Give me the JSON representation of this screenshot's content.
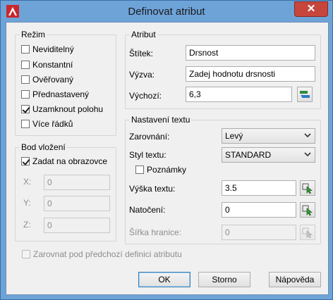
{
  "window": {
    "title": "Definovat atribut",
    "close_glyph": "✕"
  },
  "mode": {
    "legend": "Režim",
    "items": [
      {
        "label": "Neviditelný",
        "checked": false
      },
      {
        "label": "Konstantní",
        "checked": false
      },
      {
        "label": "Ověřovaný",
        "checked": false
      },
      {
        "label": "Přednastavený",
        "checked": false
      },
      {
        "label": "Uzamknout polohu",
        "checked": true
      },
      {
        "label": "Více řádků",
        "checked": false
      }
    ]
  },
  "insertion": {
    "legend": "Bod vložení",
    "specify_label": "Zadat na obrazovce",
    "specify_checked": true,
    "x_label": "X:",
    "x_value": "0",
    "y_label": "Y:",
    "y_value": "0",
    "z_label": "Z:",
    "z_value": "0"
  },
  "align_prev": {
    "label": "Zarovnat pod předchozí definici atributu",
    "checked": false
  },
  "attribute": {
    "legend": "Atribut",
    "tag_label": "Štítek:",
    "tag_value": "Drsnost",
    "prompt_label": "Výzva:",
    "prompt_value": "Zadej hodnotu drsnosti",
    "default_label": "Výchozí:",
    "default_value": "6,3"
  },
  "text_settings": {
    "legend": "Nastavení textu",
    "justification_label": "Zarovnání:",
    "justification_value": "Levý",
    "style_label": "Styl textu:",
    "style_value": "STANDARD",
    "annotative_label": "Poznámky",
    "annotative_checked": false,
    "height_label": "Výška textu:",
    "height_value": "3.5",
    "rotation_label": "Natočení:",
    "rotation_value": "0",
    "width_label": "Šířka hranice:",
    "width_value": "0"
  },
  "buttons": {
    "ok": "OK",
    "cancel": "Storno",
    "help": "Nápověda"
  }
}
